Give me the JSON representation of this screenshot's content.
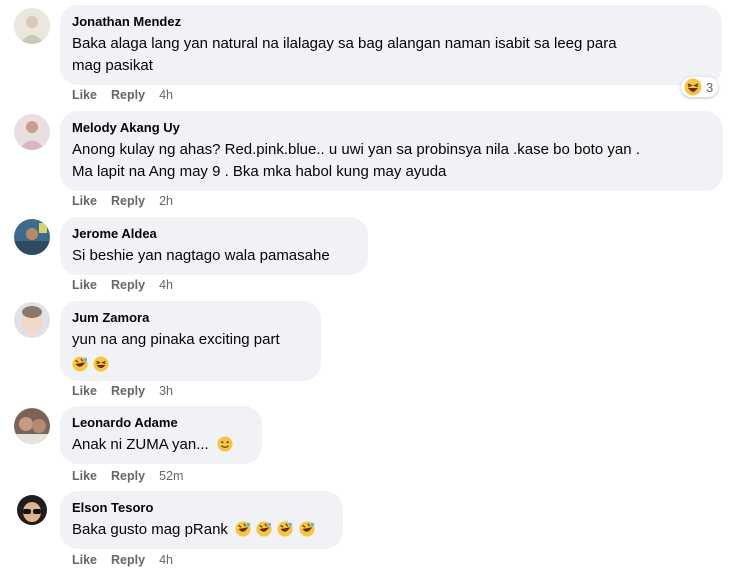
{
  "labels": {
    "like": "Like",
    "reply": "Reply"
  },
  "comments": [
    {
      "author": "Jonathan Mendez",
      "lines": [
        "Baka alaga lang yan natural na ilalagay sa bag alangan naman isabit sa leeg para",
        "mag pasikat"
      ],
      "time": "4h",
      "reaction_count": "3",
      "reaction_icon": "laughing-face-icon",
      "inline_emojis": []
    },
    {
      "author": "Melody Akang Uy",
      "lines": [
        "Anong kulay ng ahas? Red.pink.blue.. u uwi yan sa probinsya nila .kase bo boto yan .",
        "Ma lapit na Ang may 9 . Bka mka habol kung may ayuda"
      ],
      "time": "2h",
      "inline_emojis": []
    },
    {
      "author": "Jerome Aldea",
      "lines": [
        "Si beshie yan nagtago wala pamasahe"
      ],
      "time": "4h",
      "inline_emojis": []
    },
    {
      "author": "Jum Zamora",
      "lines": [
        "yun na ang pinaka exciting part"
      ],
      "time": "3h",
      "inline_emojis": [
        "rolling-laughing-emoji",
        "laughing-emoji"
      ]
    },
    {
      "author": "Leonardo Adame",
      "lines": [
        "Anak ni ZUMA yan..."
      ],
      "time": "52m",
      "inline_emojis": [
        "smiling-emoji"
      ]
    },
    {
      "author": "Elson Tesoro",
      "lines": [
        "Baka gusto mag pRank"
      ],
      "time": "4h",
      "inline_emojis": [
        "rolling-laughing-emoji",
        "rolling-laughing-emoji",
        "rolling-laughing-emoji",
        "rolling-laughing-emoji"
      ]
    }
  ]
}
